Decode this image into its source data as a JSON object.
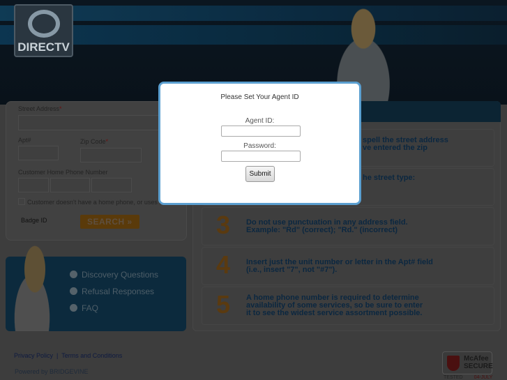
{
  "brand": {
    "logo_text": "DIRECTV"
  },
  "form": {
    "street_label": "Street Address",
    "apt_label": "Apt#",
    "zip_label": "Zip Code",
    "required_mark": "*",
    "phone_label": "Customer Home Phone Number",
    "no_phone_label": "Customer doesn't have a home phone, or uses a",
    "badge_label": "Badge ID",
    "search_label": "SEARCH"
  },
  "tips": [
    {
      "num": "1",
      "text": "spell the street address\nve entered the zip"
    },
    {
      "num": "2",
      "text": "he street type:"
    },
    {
      "num": "3",
      "text": "Do not use punctuation in any address field.\nExample: \"Rd\" (correct); \"Rd.\" (incorrect)"
    },
    {
      "num": "4",
      "text": "Insert just the unit number or letter in the Apt# field\n(i.e., insert \"7\", not \"#7\")."
    },
    {
      "num": "5",
      "text": "A home phone number is required to determine\navailability of some services, so be sure to enter\nit to see the widest service assortment possible."
    }
  ],
  "links": {
    "items": [
      "Discovery Questions",
      "Refusal Responses",
      "FAQ"
    ]
  },
  "footer": {
    "privacy": "Privacy Policy",
    "separator": "|",
    "terms": "Terms and Conditions",
    "powered": "Powered by BRIDGEVINE",
    "mcafee_line1": "McAfee",
    "mcafee_line2": "SECURE",
    "tested": "TESTED",
    "tested_date": "04-JULY"
  },
  "modal": {
    "title": "Please Set Your Agent ID",
    "agent_label": "Agent ID:",
    "agent_value": "",
    "password_label": "Password:",
    "password_value": "",
    "submit_label": "Submit"
  },
  "colors": {
    "modal_border": "#5b9fd0",
    "overlay": "#3d3d3d",
    "accent_orange": "#e08a1e",
    "tip_text": "#0b5a9a"
  }
}
